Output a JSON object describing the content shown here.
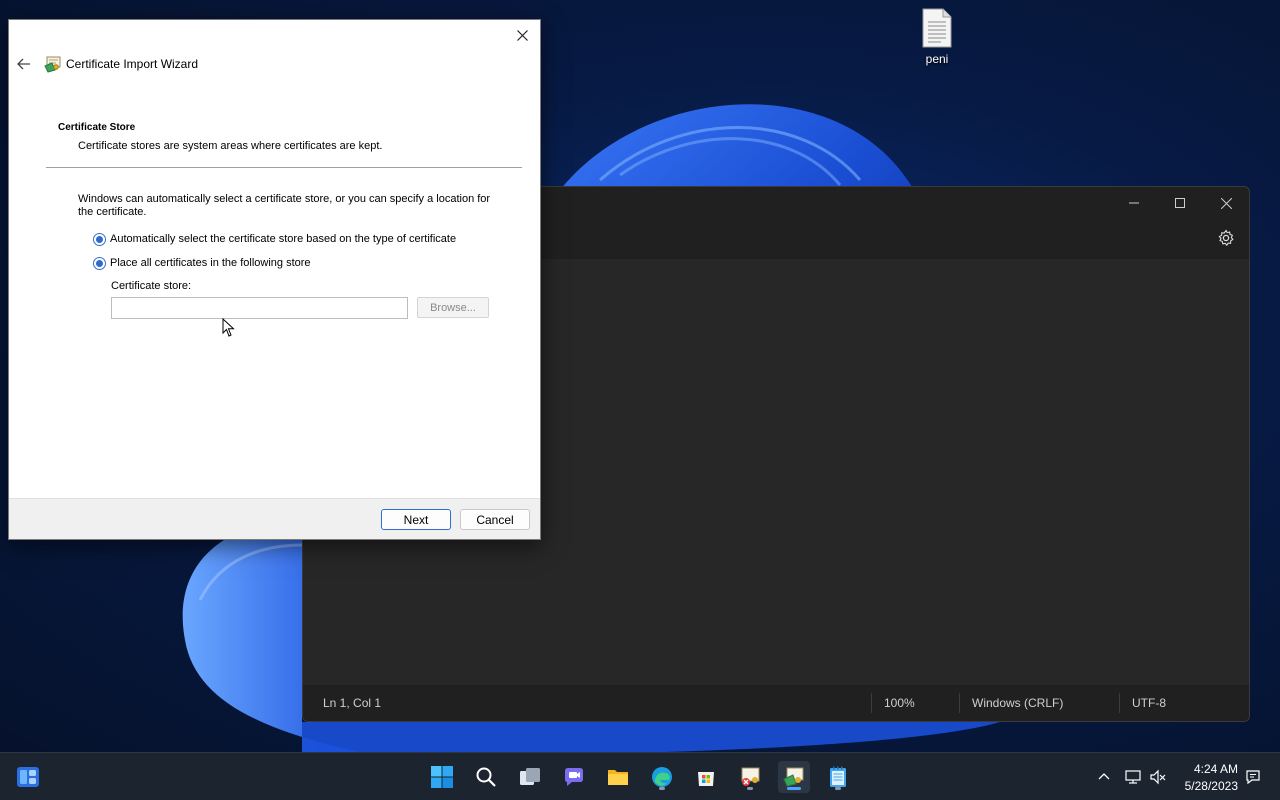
{
  "desktop": {
    "icons": [
      {
        "label": "peni",
        "icon": "text-document-icon"
      }
    ]
  },
  "wizard": {
    "title": "Certificate Import Wizard",
    "section_title": "Certificate Store",
    "section_desc": "Certificate stores are system areas where certificates are kept.",
    "intro": "Windows can automatically select a certificate store, or you can specify a location for the certificate.",
    "radio_auto_label": "Automatically select the certificate store based on the type of certificate",
    "radio_place_label": "Place all certificates in the following store",
    "store_label": "Certificate store:",
    "store_value": "",
    "browse_label": "Browse...",
    "next_label": "Next",
    "cancel_label": "Cancel"
  },
  "notepad": {
    "status": {
      "position": "Ln 1, Col 1",
      "zoom": "100%",
      "line_ending": "Windows (CRLF)",
      "encoding": "UTF-8"
    }
  },
  "taskbar": {
    "apps": [
      "start-icon",
      "search-icon",
      "task-view-icon",
      "teams-chat-icon",
      "file-explorer-icon",
      "edge-icon",
      "store-icon",
      "certificate-manager-icon",
      "certificate-wizard-icon",
      "notepad-icon"
    ],
    "clock_time": "4:24 AM",
    "clock_date": "5/28/2023"
  },
  "colors": {
    "accent": "#2e6bd0",
    "taskbar": "#1c2430",
    "notepad_bg": "#272727"
  }
}
